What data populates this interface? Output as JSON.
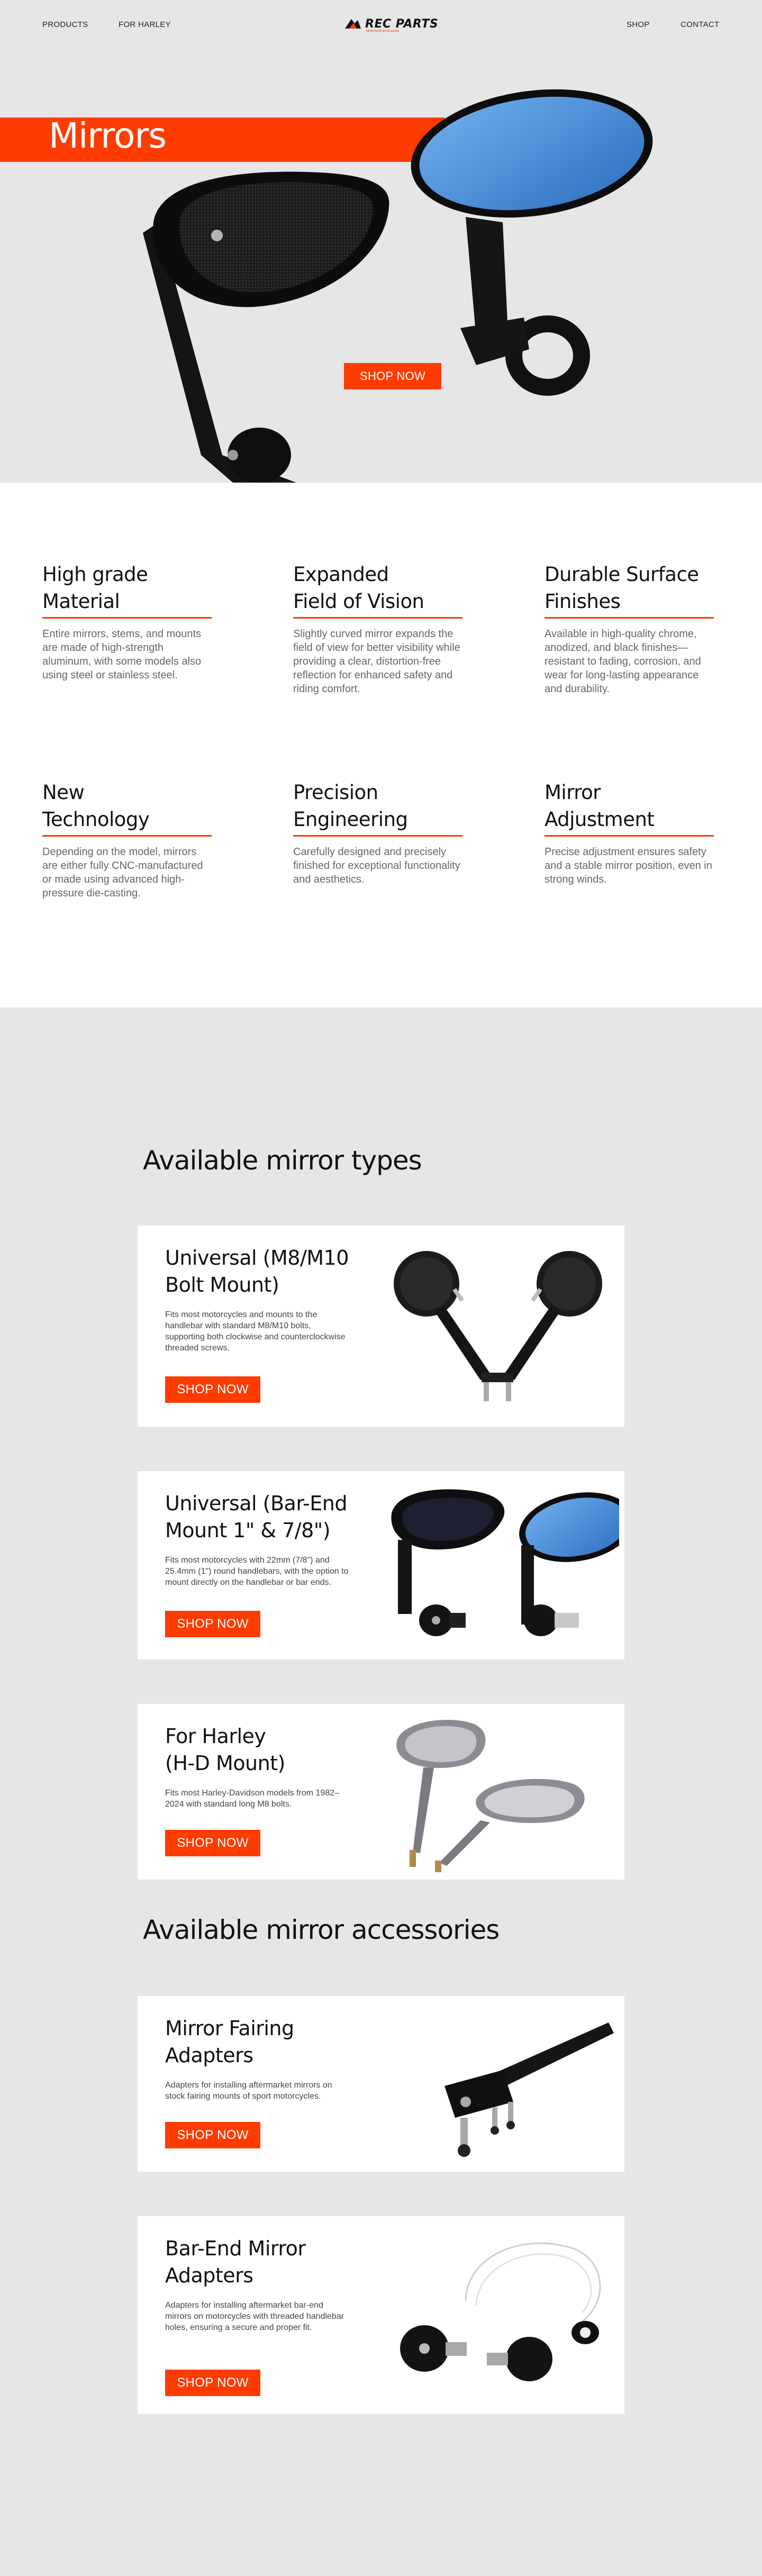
{
  "nav": {
    "left": [
      "PRODUCTS",
      "FOR HARLEY"
    ],
    "right": [
      "SHOP",
      "CONTACT"
    ],
    "logo_text": "REC PARTS",
    "logo_tagline": "Motorcycle accessories"
  },
  "hero": {
    "title": "Mirrors",
    "cta": "SHOP NOW"
  },
  "features": [
    {
      "title": "High grade\nMaterial",
      "text": "Entire mirrors, stems, and mounts are made of  high-strength aluminum, with some models also using steel or stainless steel."
    },
    {
      "title": "Expanded\nField of Vision",
      "text": "Slightly curved mirror  expands the field of view for better visibility while providing a  clear, distortion-free reflection for enhanced safety and riding comfort."
    },
    {
      "title": "Durable Surface\nFinishes",
      "text": "Available  in high-quality chrome, anodized, and black finishes—resistant to  fading, corrosion, and wear for long-lasting appearance and durability."
    },
    {
      "title": "New\nTechnology",
      "text": "Depending on the model, mirrors are either  fully CNC-manufactured or made using advanced high-pressure  die-casting."
    },
    {
      "title": "Precision\nEngineering",
      "text": "Carefully  designed and precisely finished for exceptional functionality and aesthetics."
    },
    {
      "title": "Mirror\nAdjustment",
      "text": "Precise  adjustment ensures safety and a stable mirror position, even in  strong winds."
    }
  ],
  "types": {
    "title": "Available mirror types",
    "cards": [
      {
        "title": "Universal (M8/M10\nBolt Mount)",
        "text": "Fits most  motorcycles and mounts to the handlebar with standard M8/M10 bolts, supporting both clockwise and counterclockwise threaded screws.",
        "cta": "SHOP NOW"
      },
      {
        "title": "Universal (Bar-End\nMount 1\" & 7/8\")",
        "text": "Fits most  motorcycles with 22mm (7/8\") and 25.4mm (1\") round handlebars, with  the option to mount directly on the handlebar or bar ends.",
        "cta": "SHOP NOW"
      },
      {
        "title": "For Harley\n(H-D Mount)",
        "text": "Fits most  Harley-Davidson models from 1982–2024 with standard long M8 bolts.",
        "cta": "SHOP NOW"
      }
    ]
  },
  "accessories": {
    "title": "Available mirror accessories",
    "cards": [
      {
        "title": "Mirror Fairing\nAdapters",
        "text": "Adapters for installing  aftermarket mirrors on stock fairing mounts of sport motorcycles.",
        "cta": "SHOP NOW"
      },
      {
        "title": "Bar-End Mirror\nAdapters",
        "text": "Adapters  for installing aftermarket bar-end mirrors on  motorcycles with threaded handlebar holes, ensuring a secure and proper fit.",
        "cta": "SHOP NOW"
      }
    ]
  },
  "colors": {
    "accent": "#fe3c00",
    "gray_bg": "#e6e6e6",
    "mirror_blue": "#4a8fd6"
  },
  "icons": [
    "rec-parts-logo-icon"
  ]
}
